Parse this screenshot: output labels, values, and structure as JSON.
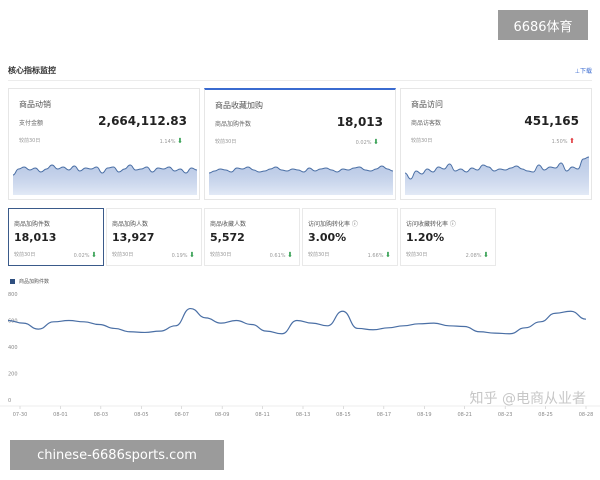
{
  "brand": "6686体育",
  "section": {
    "title": "核心指标监控",
    "download": "⊥下载"
  },
  "big_cards": [
    {
      "title": "商品动销",
      "sub": "支付金额",
      "value": "2,664,112.83",
      "compare": "较前30日",
      "pct": "1.14%",
      "trend": "down",
      "spark": [
        16,
        22,
        24,
        21,
        23,
        19,
        22,
        26,
        22,
        24,
        21,
        25,
        20,
        23,
        22,
        24,
        18,
        23,
        24,
        19,
        22,
        26,
        21,
        22,
        24,
        19,
        23,
        22,
        24,
        20,
        22,
        18,
        23,
        21
      ]
    },
    {
      "title": "商品收藏加购",
      "sub": "商品加购件数",
      "value": "18,013",
      "compare": "较前30日",
      "pct": "0.02%",
      "trend": "down",
      "spark": [
        18,
        20,
        22,
        21,
        19,
        23,
        22,
        24,
        21,
        19,
        20,
        22,
        24,
        21,
        20,
        22,
        21,
        19,
        23,
        20,
        22,
        23,
        21,
        19,
        22,
        21,
        23,
        24,
        21,
        20,
        22,
        25,
        22,
        20
      ]
    },
    {
      "title": "商品访问",
      "sub": "商品访客数",
      "value": "451,165",
      "compare": "较前30日",
      "pct": "1.50%",
      "trend": "up",
      "spark": [
        18,
        12,
        20,
        17,
        22,
        19,
        24,
        22,
        27,
        20,
        22,
        19,
        23,
        21,
        26,
        24,
        20,
        22,
        21,
        23,
        25,
        22,
        20,
        19,
        26,
        21,
        24,
        23,
        28,
        20,
        24,
        22,
        32,
        34
      ]
    }
  ],
  "kpis": [
    {
      "title": "商品加购件数",
      "value": "18,013",
      "compare": "较前30日",
      "pct": "0.02%",
      "trend": "down",
      "active": true
    },
    {
      "title": "商品加购人数",
      "value": "13,927",
      "compare": "较前30日",
      "pct": "0.19%",
      "trend": "down",
      "active": false
    },
    {
      "title": "商品收藏人数",
      "value": "5,572",
      "compare": "较前30日",
      "pct": "0.61%",
      "trend": "down",
      "active": false
    },
    {
      "title": "访问加购转化率 ⓘ",
      "value": "3.00%",
      "compare": "较前30日",
      "pct": "1.66%",
      "trend": "down",
      "active": false
    },
    {
      "title": "访问收藏转化率 ⓘ",
      "value": "1.20%",
      "compare": "较前30日",
      "pct": "2.08%",
      "trend": "down",
      "active": false
    }
  ],
  "chart_data": {
    "type": "line",
    "series": [
      {
        "name": "商品加购件数",
        "values": [
          600,
          580,
          535,
          590,
          600,
          590,
          570,
          540,
          515,
          510,
          520,
          560,
          690,
          620,
          580,
          600,
          570,
          520,
          500,
          600,
          580,
          560,
          670,
          540,
          530,
          545,
          560,
          575,
          580,
          560,
          555,
          515,
          505,
          500,
          545,
          590,
          655,
          670,
          610
        ]
      }
    ],
    "x_tick_labels": [
      "07-30",
      "08-01",
      "08-03",
      "08-05",
      "08-07",
      "08-09",
      "08-11",
      "08-13",
      "08-15",
      "08-17",
      "08-19",
      "08-21",
      "08-23",
      "08-25",
      "08-28"
    ],
    "y_tick_labels": [
      "800",
      "600",
      "400",
      "200",
      "0"
    ],
    "ylim": [
      0,
      800
    ],
    "grid": false,
    "legend": "top-left",
    "color": "#4a6fa5"
  },
  "watermark": "知乎 @电商从业者",
  "site": "chinese-6686sports.com"
}
